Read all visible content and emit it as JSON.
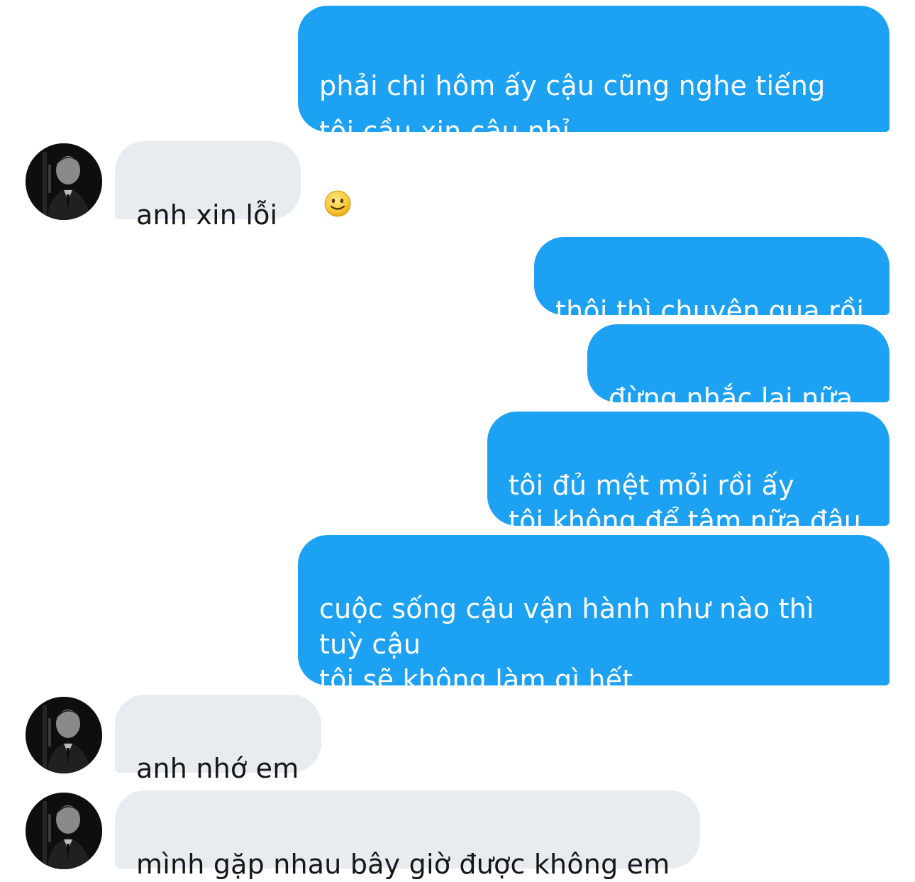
{
  "conversation": {
    "messages": [
      {
        "direction": "sent",
        "text": "phải chi hôm ấy cậu cũng nghe tiếng\ntôi cầu xin cậu nhỉ",
        "emoji": "slightly-smiling-face"
      },
      {
        "direction": "received",
        "text": "anh xin lỗi"
      },
      {
        "direction": "sent",
        "text": "thôi thì chuyện qua rồi"
      },
      {
        "direction": "sent",
        "text": "đừng nhắc lại nữa"
      },
      {
        "direction": "sent",
        "text": "tôi đủ mệt mỏi rồi ấy\ntôi không để tâm nữa đâu"
      },
      {
        "direction": "sent",
        "text": "cuộc sống cậu vận hành như nào thì\ntuỳ cậu\ntôi sẽ không làm gì hết"
      },
      {
        "direction": "received",
        "text": "anh nhớ em"
      },
      {
        "direction": "received",
        "text": "mình gặp nhau bây giờ được không em"
      }
    ]
  },
  "colors": {
    "sent_bubble": "#1da1f2",
    "received_bubble": "#e6ecf0",
    "sent_text": "#ffffff",
    "received_text": "#14171a"
  },
  "icons": {
    "avatar": "contact-avatar-photo",
    "emoji": "slightly-smiling-face-emoji"
  }
}
